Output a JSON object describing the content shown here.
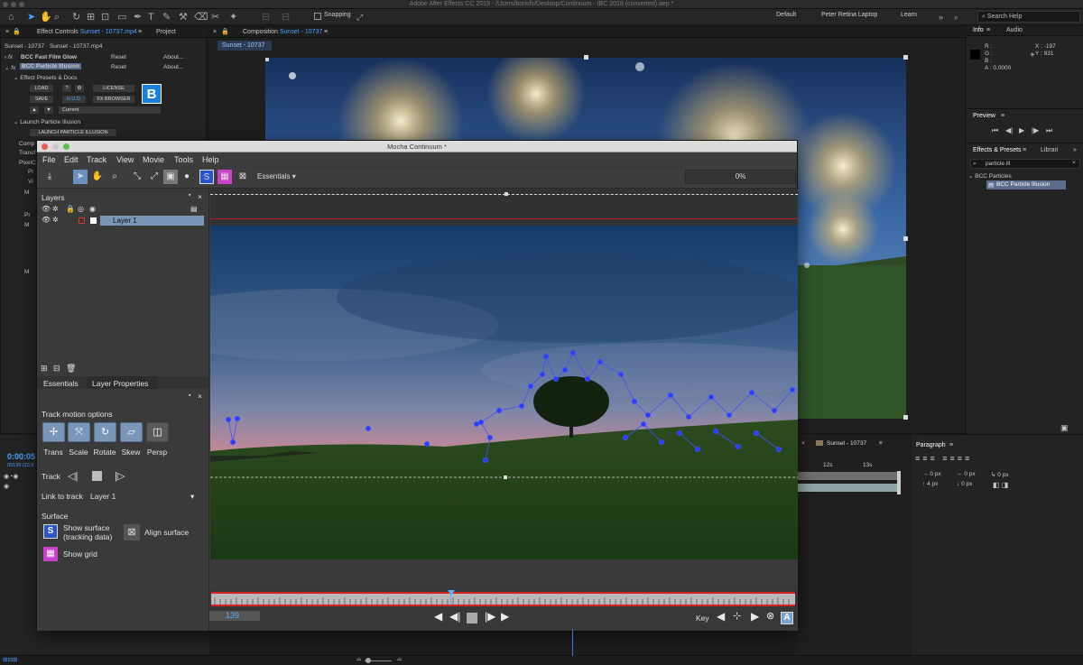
{
  "app_title": "Adobe After Effects CC 2019 - /Users/borisfx/Desktop/Continuum - IBC 2018 (converted).aep *",
  "toolbar": {
    "snapping_label": "Snapping",
    "workspaces": [
      "Default",
      "Peter Retina Laptop",
      "Learn"
    ],
    "search_placeholder": "Search Help"
  },
  "effect_controls": {
    "tab_label": "Effect Controls",
    "tab_file": "Sunset - 10737.mp4",
    "project_tab": "Project",
    "breadcrumb": "Sunset - 10737 · Sunset - 10737.mp4",
    "effects": [
      {
        "name": "BCC Fast Film Glow",
        "reset": "Reset",
        "about": "About..."
      },
      {
        "name": "BCC Particle Illusion",
        "reset": "Reset",
        "about": "About..."
      }
    ],
    "presets_label": "Effect Presets & Docs",
    "buttons": {
      "load": "LOAD",
      "help": "?",
      "license": "LICENSE",
      "save": "SAVE",
      "hud": "H.U.D.",
      "fx_browser": "FX BROWSER",
      "current": "Current"
    },
    "launch_section": "Launch Particle Illusion",
    "launch_button": "LAUNCH PARTICLE ILLUSION",
    "partial_rows": [
      "Comp",
      "Transf",
      "PixelC",
      "Pi",
      "Vi",
      "M",
      "Pr",
      "M",
      "M"
    ]
  },
  "composition": {
    "tab_label": "Composition",
    "comp_name": "Sunset - 10737",
    "sub_tab": "Sunset - 10737"
  },
  "mocha": {
    "window_title": "Mocha Continuum *",
    "menu": [
      "File",
      "Edit",
      "Track",
      "View",
      "Movie",
      "Tools",
      "Help"
    ],
    "workspace": "Essentials",
    "progress": "0%",
    "layers_header": "Layers",
    "layers": [
      {
        "name": "Layer 1"
      }
    ],
    "tabs": [
      "Essentials",
      "Layer Properties"
    ],
    "track_motion_label": "Track motion options",
    "motion_options": [
      "Trans",
      "Scale",
      "Rotate",
      "Skew",
      "Persp"
    ],
    "track_label": "Track",
    "link_to_track_label": "Link to track",
    "link_to_track_value": "Layer 1",
    "surface_label": "Surface",
    "show_surface_label": "Show surface",
    "show_surface_sub": "(tracking data)",
    "align_surface_label": "Align surface",
    "show_grid_label": "Show grid",
    "current_frame": "139",
    "key_label": "Key"
  },
  "info_panel": {
    "tab": "Info",
    "audio_tab": "Audio",
    "r": "R :",
    "g": "G :",
    "b": "B :",
    "a": "A : 0.0000",
    "x": "X : -197",
    "y": "Y : 931"
  },
  "preview_panel": {
    "tab": "Preview"
  },
  "effects_presets": {
    "tab": "Effects & Presets",
    "libraries_tab": "Librari",
    "search_value": "particle ill",
    "category": "BCC Particles",
    "item": "BCC Particle Illusion"
  },
  "timeline_panel": {
    "timecode": "0:00:05",
    "frame_info": "00139 (23.9",
    "comp_tab": "Sunset - 10737",
    "ruler_labels": [
      "12s",
      "13s"
    ]
  },
  "paragraph_panel": {
    "tab": "Paragraph",
    "values": [
      "0 px",
      "0 px",
      "0 px",
      "4 px",
      "0 px",
      "0 px"
    ]
  },
  "colors": {
    "accent": "#4aa0ff",
    "timeline_border": "#d02020",
    "track_points": "#2a3cff"
  }
}
